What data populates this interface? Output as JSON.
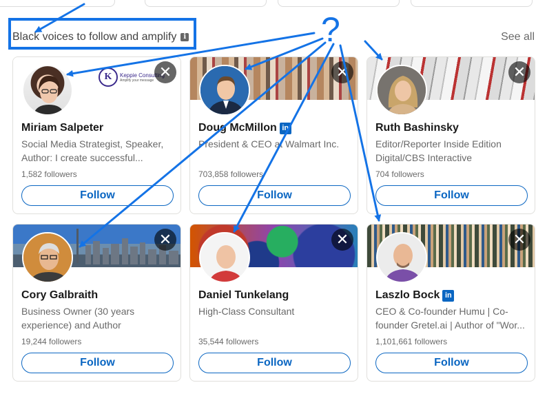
{
  "section": {
    "title": "Black voices to follow and amplify",
    "see_all": "See all"
  },
  "banner_logo_text": "Keppie Consulting",
  "banner_logo_tagline": "Amplify your message",
  "annotation": {
    "question_mark": "?"
  },
  "cards": [
    {
      "name": "Miriam Salpeter",
      "badge": false,
      "headline": "Social Media Strategist, Speaker, Author: I create successful...",
      "followers": "1,582 followers",
      "follow": "Follow"
    },
    {
      "name": "Doug McMillon",
      "badge": true,
      "headline": "President & CEO at Walmart Inc.",
      "followers": "703,858 followers",
      "follow": "Follow"
    },
    {
      "name": "Ruth Bashinsky",
      "badge": false,
      "headline": "Editor/Reporter Inside Edition Digital/CBS Interactive",
      "followers": "704 followers",
      "follow": "Follow"
    },
    {
      "name": "Cory Galbraith",
      "badge": false,
      "headline": "Business Owner (30 years experience) and Author",
      "followers": "19,244 followers",
      "follow": "Follow"
    },
    {
      "name": "Daniel Tunkelang",
      "badge": false,
      "headline": "High-Class Consultant",
      "followers": "35,544 followers",
      "follow": "Follow"
    },
    {
      "name": "Laszlo Bock",
      "badge": true,
      "headline": "CEO & Co-founder Humu | Co-founder Gretel.ai | Author of \"Wor...",
      "followers": "1,101,661 followers",
      "follow": "Follow"
    }
  ],
  "icons": {
    "dismiss": "close-icon",
    "info": "info-icon",
    "badge": "linkedin-badge-icon"
  },
  "colors": {
    "accent": "#0a66c2",
    "annotation": "#1473e6"
  }
}
